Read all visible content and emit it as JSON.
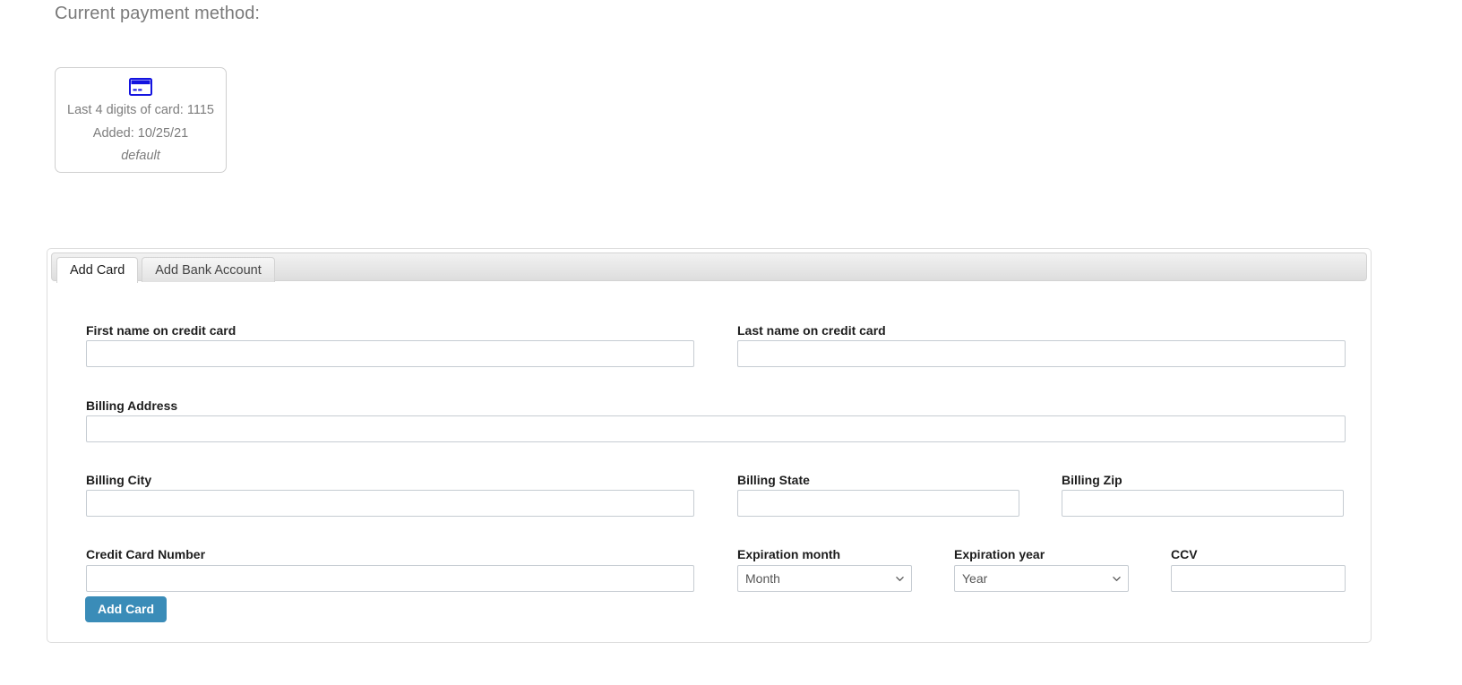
{
  "page": {
    "heading": "Current payment method:"
  },
  "saved_card": {
    "icon": "credit-card-icon",
    "icon_color": "#1414e0",
    "last4_line": "Last 4 digits of card: 1115",
    "added_line": "Added: 10/25/21",
    "default_line": "default"
  },
  "tabs": [
    {
      "label": "Add Card",
      "active": true
    },
    {
      "label": "Add Bank Account",
      "active": false
    }
  ],
  "form": {
    "first_name": {
      "label": "First name on credit card",
      "value": "",
      "placeholder": ""
    },
    "last_name": {
      "label": "Last name on credit card",
      "value": "",
      "placeholder": ""
    },
    "billing_address": {
      "label": "Billing Address",
      "value": "",
      "placeholder": ""
    },
    "billing_city": {
      "label": "Billing City",
      "value": "",
      "placeholder": ""
    },
    "billing_state": {
      "label": "Billing State",
      "value": "",
      "placeholder": ""
    },
    "billing_zip": {
      "label": "Billing Zip",
      "value": "",
      "placeholder": ""
    },
    "card_number": {
      "label": "Credit Card Number",
      "value": "",
      "placeholder": ""
    },
    "expiration_month": {
      "label": "Expiration month",
      "selected": "Month"
    },
    "expiration_year": {
      "label": "Expiration year",
      "selected": "Year"
    },
    "ccv": {
      "label": "CCV",
      "value": "",
      "placeholder": ""
    },
    "submit_label": "Add Card"
  },
  "colors": {
    "accent_button": "#3a8cb8",
    "card_icon": "#1414e0",
    "label_text": "#1d1d1d",
    "muted_text": "#7d7d7d",
    "input_border": "#c6ccd2",
    "panel_border": "#dddddd"
  }
}
